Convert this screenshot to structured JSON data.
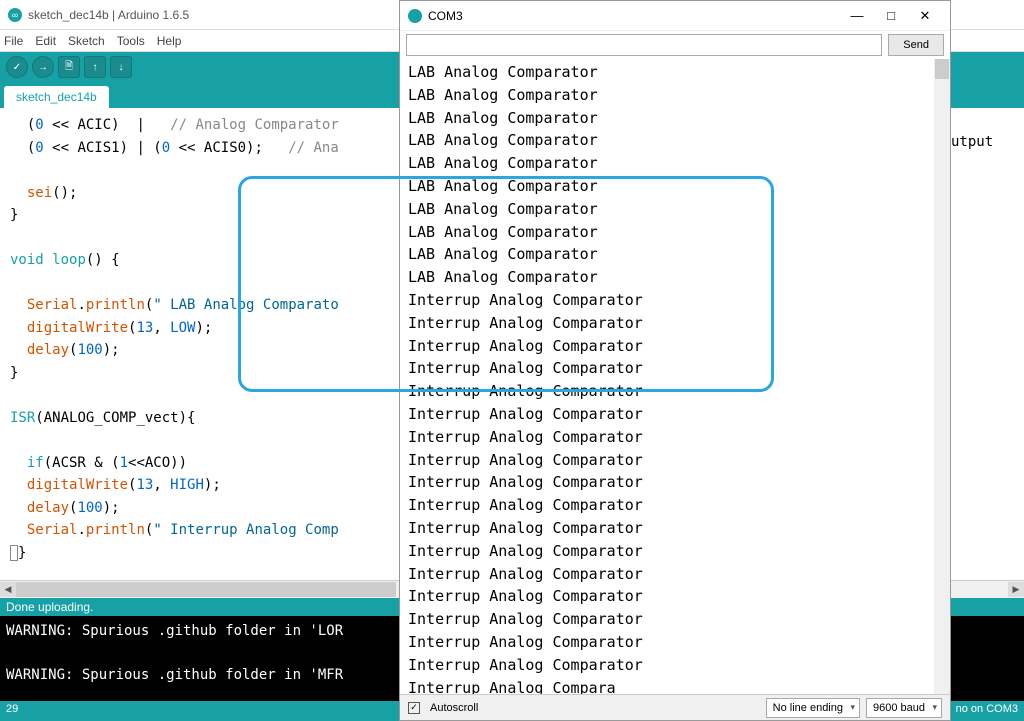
{
  "ide": {
    "title": "sketch_dec14b | Arduino 1.6.5",
    "menu": [
      "File",
      "Edit",
      "Sketch",
      "Tools",
      "Help"
    ],
    "tab": "sketch_dec14b",
    "statusMsg": "Done uploading.",
    "bottomLeft": "29",
    "bottomRight": "no on COM3",
    "consoleLine1": "WARNING: Spurious .github folder in 'LOR",
    "consoleLine2": "WARNING: Spurious .github folder in 'MFR",
    "code": {
      "l1a": "  (",
      "l1b": "0",
      "l1c": " << ACIC)  |   ",
      "l1d": "// Analog Comparator ",
      "l2a": "  (",
      "l2b": "0",
      "l2c": " << ACIS1) | (",
      "l2d": "0",
      "l2e": " << ACIS0);   ",
      "l2f": "// Ana",
      "l2peek": "utput",
      "l3": "",
      "l4a": "  sei",
      "l4b": "();",
      "l5": "}",
      "l6": "",
      "l7a": "void",
      "l7b": " ",
      "l7c": "loop",
      "l7d": "() {",
      "l8": "",
      "l9a": "  ",
      "l9b": "Serial",
      "l9c": ".",
      "l9d": "println",
      "l9e": "(",
      "l9f": "\" LAB Analog Comparato",
      "l9g": "",
      "l10a": "  ",
      "l10b": "digitalWrite",
      "l10c": "(",
      "l10d": "13",
      "l10e": ", ",
      "l10f": "LOW",
      "l10g": ");",
      "l11a": "  ",
      "l11b": "delay",
      "l11c": "(",
      "l11d": "100",
      "l11e": ");",
      "l12": "}",
      "l13": "",
      "l14a": "ISR",
      "l14b": "(ANALOG_COMP_vect){",
      "l15": "",
      "l16a": "  if",
      "l16b": "(ACSR & (",
      "l16c": "1",
      "l16d": "<<ACO))",
      "l17a": "  ",
      "l17b": "digitalWrite",
      "l17c": "(",
      "l17d": "13",
      "l17e": ", ",
      "l17f": "HIGH",
      "l17g": ");",
      "l18a": "  ",
      "l18b": "delay",
      "l18c": "(",
      "l18d": "100",
      "l18e": ");",
      "l19a": "  ",
      "l19b": "Serial",
      "l19c": ".",
      "l19d": "println",
      "l19e": "(",
      "l19f": "\" Interrup Analog Comp",
      "l20": ""
    }
  },
  "serial": {
    "title": "COM3",
    "sendLabel": "Send",
    "autoscroll": "Autoscroll",
    "lineEnding": "No line ending",
    "baud": "9600 baud",
    "lines": [
      " LAB Analog Comparator",
      " LAB Analog Comparator",
      " LAB Analog Comparator",
      " LAB Analog Comparator",
      " LAB Analog Comparator",
      " LAB Analog Comparator",
      " LAB Analog Comparator",
      " LAB Analog Comparator",
      " LAB Analog Comparator",
      " LAB Analog Comparator",
      " Interrup Analog Comparator",
      " Interrup Analog Comparator",
      " Interrup Analog Comparator",
      " Interrup Analog Comparator",
      " Interrup Analog Comparator",
      " Interrup Analog Comparator",
      " Interrup Analog Comparator",
      " Interrup Analog Comparator",
      " Interrup Analog Comparator",
      " Interrup Analog Comparator",
      " Interrup Analog Comparator",
      " Interrup Analog Comparator",
      " Interrup Analog Comparator",
      " Interrup Analog Comparator",
      " Interrup Analog Comparator",
      " Interrup Analog Comparator",
      " Interrup Analog Comparator",
      " Interrup Analog Compara"
    ]
  }
}
